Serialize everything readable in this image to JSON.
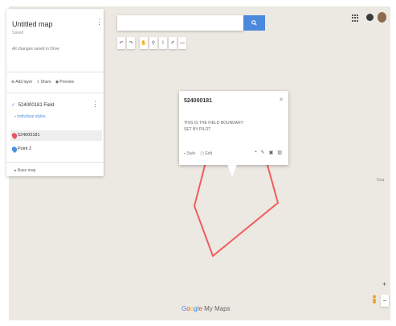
{
  "colors": {
    "map_background": "#ece8e2",
    "accent_blue": "#4a89dc",
    "polygon_stroke": "#f25c5c",
    "marker_red": "#e25563",
    "marker_blue": "#4a90e2"
  },
  "left_panel": {
    "title": "Untitled map",
    "subtitle": "Saved",
    "description": "All changes saved in Drive",
    "actions": [
      {
        "icon": "add-layer-icon",
        "label": "Add layer"
      },
      {
        "icon": "share-icon",
        "label": "Share"
      },
      {
        "icon": "preview-icon",
        "label": "Preview"
      }
    ],
    "layer": {
      "name": "524000181 Field",
      "style_link": "Individual styles",
      "items": [
        {
          "icon": "red-marker-icon",
          "label": "524000181"
        },
        {
          "icon": "blue-marker-icon",
          "label": "Point 2"
        }
      ]
    },
    "base_map": "Base map"
  },
  "search": {
    "placeholder": "",
    "button_icon": "search-icon"
  },
  "toolbar": {
    "tools": [
      {
        "icon": "undo-icon"
      },
      {
        "icon": "redo-icon"
      },
      {
        "icon": "hand-icon"
      },
      {
        "icon": "marker-icon"
      },
      {
        "icon": "draw-line-icon"
      },
      {
        "icon": "directions-icon"
      },
      {
        "icon": "ruler-icon"
      }
    ]
  },
  "top_right": {
    "apps_icon": "apps-grid-icon",
    "account_icon": "account-icon",
    "avatar": "avatar"
  },
  "popup": {
    "title": "524000181",
    "body": "THIS IS THE FIELD BOUNDARY\nSET BY PILOT",
    "footer_left": [
      "Style",
      "Edit"
    ],
    "tools": [
      "paint-icon",
      "pencil-icon",
      "camera-icon",
      "delete-icon"
    ]
  },
  "map": {
    "side_label": "Goa",
    "footer_logo": [
      "G",
      "o",
      "o",
      "g",
      "l",
      "e"
    ],
    "footer_text": "My Maps"
  }
}
